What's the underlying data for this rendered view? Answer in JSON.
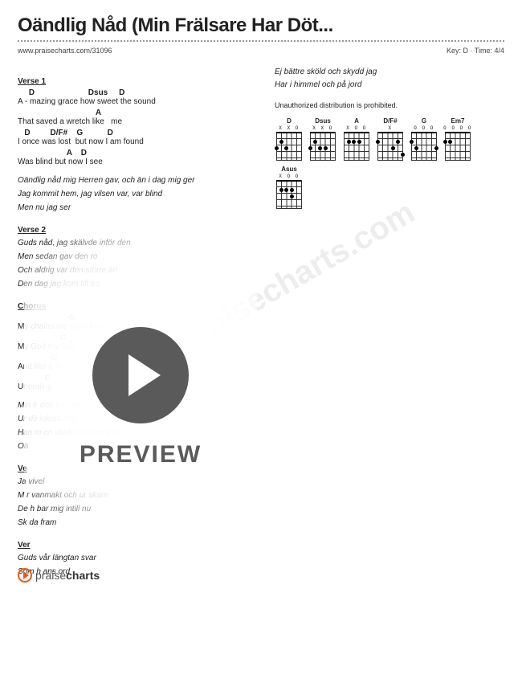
{
  "title": "Oändlig Nåd (Min Frälsare Har Döt...",
  "meta": {
    "url": "www.praisecharts.com/31096",
    "key_time": "Key: D · Time: 4/4"
  },
  "sections": {
    "verse1": {
      "label": "Verse 1",
      "lines": [
        {
          "chords": "     D                        Dsus     D",
          "lyric": "A - mazing grace how sweet the sound"
        },
        {
          "chords": "                                   A",
          "lyric": "That saved a wretch like   me"
        },
        {
          "chords": "   D         D/F#    G           D",
          "lyric": "I once was lost  but now I am found"
        },
        {
          "chords": "                      A    D",
          "lyric": "Was blind but now I see"
        }
      ],
      "translation": [
        "Oändlig nåd mig Herren gav, och än i dag mig ger",
        "Jag kommit hem, jag vilsen var, var blind",
        "Men nu jag ser"
      ]
    },
    "verse2": {
      "label": "Verse 2",
      "lines": [
        "Guds nåd, jag skälvde inför den",
        "Men sedan gav den ro",
        "Och aldrig var den större än",
        "Den dag jag kom till tro"
      ]
    },
    "chorus": {
      "label": "Chorus",
      "lines": [
        {
          "chords": "                       G",
          "lyric": "My chains are gone I've"
        },
        {
          "chords": "                   G                        #",
          "lyric": "My God my Savi                      d  me"
        },
        {
          "chords": "               G                  F#",
          "lyric": "And like a flo                    reigns"
        },
        {
          "chords": "            E                       D",
          "lyric": "Unending                  amazing grace"
        }
      ],
      "translation": [
        "Min fr                  dött för mig",
        "Ur dö                   inköpt mig",
        "Han                m en väldig flod, evig kä",
        "Oä"
      ]
    },
    "verse3": {
      "label": "Ve",
      "lines": [
        "Ja                 vivel",
        "M                r vanmakt och ur skam",
        "De           h bar mig intill nu",
        "Sk                 da fram"
      ]
    },
    "verse4": {
      "label": "Ver",
      "lines": [
        "Guds                    vår längtan svar",
        "Som h              ans ord"
      ]
    }
  },
  "right_column": {
    "lines": [
      "Ej bättre sköld och skydd jag",
      "Har i himmel och på jord"
    ],
    "notice": "Unauthorized distribution is prohibited."
  },
  "chord_diagrams": [
    {
      "name": "D",
      "markers": "X X O"
    },
    {
      "name": "Dsus",
      "markers": "X X O"
    },
    {
      "name": "A",
      "markers": "X O   O"
    },
    {
      "name": "D/F#",
      "markers": "  X"
    },
    {
      "name": "G",
      "markers": "    O O O"
    },
    {
      "name": "Em7",
      "markers": "O   O O O"
    },
    {
      "name": "Asus",
      "markers": "X O   O"
    }
  ],
  "watermark": "www.praisecharts.com",
  "preview_label": "PREVIEW",
  "footer": {
    "brand_prefix": "praise",
    "brand_suffix": "charts"
  }
}
